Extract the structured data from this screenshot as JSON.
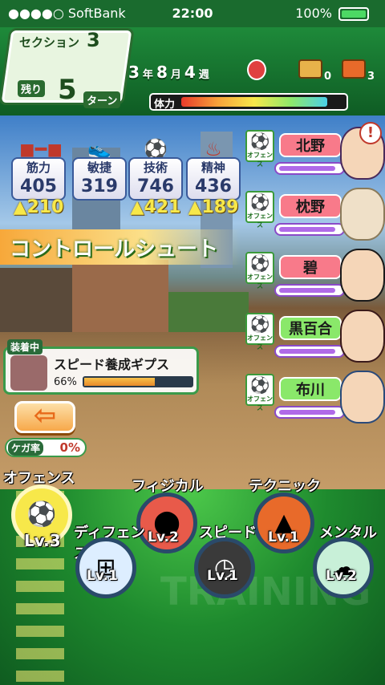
{
  "status_bar": {
    "carrier": "●●●●○ SoftBank",
    "time": "22:00",
    "battery": "100%"
  },
  "header": {
    "section_label": "セクション",
    "section_num": "3",
    "remaining_label": "残り",
    "turns_remaining": "5",
    "turn_label": "ターン",
    "date": {
      "year": "3",
      "year_unit": "年",
      "month": "8",
      "month_unit": "月",
      "week": "4",
      "week_unit": "週"
    },
    "chest1_count": "0",
    "chest2_count": "3",
    "stamina_label": "体力",
    "stamina_fraction": 0.92
  },
  "stats": [
    {
      "name": "筋力",
      "value": "405",
      "gain": "▲210",
      "icon": "dumbbell-icon"
    },
    {
      "name": "敏捷",
      "value": "319",
      "gain": "",
      "icon": "shoe-icon"
    },
    {
      "name": "技術",
      "value": "746",
      "gain": "▲421",
      "icon": "soccer-ball-icon"
    },
    {
      "name": "精神",
      "value": "436",
      "gain": "▲189",
      "icon": "spirit-icon"
    }
  ],
  "banner_text": "コントロールシュート",
  "members": [
    {
      "name": "北野",
      "badge": "オフェンス",
      "color": "pink"
    },
    {
      "name": "枕野",
      "badge": "オフェンス",
      "color": "pink"
    },
    {
      "name": "碧",
      "badge": "オフェンス",
      "color": "pink"
    },
    {
      "name": "黒百合",
      "badge": "オフェンス",
      "color": "green"
    },
    {
      "name": "布川",
      "badge": "オフェンス",
      "color": "green"
    }
  ],
  "equipment": {
    "tag": "装着中",
    "name": "スピード養成ギプス",
    "progress": "66%",
    "progress_fraction": 0.66
  },
  "injury": {
    "label": "ケガ率",
    "value": "0%"
  },
  "trainings": [
    {
      "name": "オフェンス",
      "level": "Lv.3"
    },
    {
      "name": "フィジカル",
      "level": "Lv.2"
    },
    {
      "name": "テクニック",
      "level": "Lv.1"
    },
    {
      "name": "ディフェンス",
      "level": "Lv.1"
    },
    {
      "name": "スピード",
      "level": "Lv.1"
    },
    {
      "name": "メンタル",
      "level": "Lv.2"
    }
  ],
  "field_text": "TRAINING",
  "colors": {
    "accent": "#1e8a3a",
    "stamina_start": "#e83a2a",
    "stamina_end": "#4ad0e8"
  }
}
